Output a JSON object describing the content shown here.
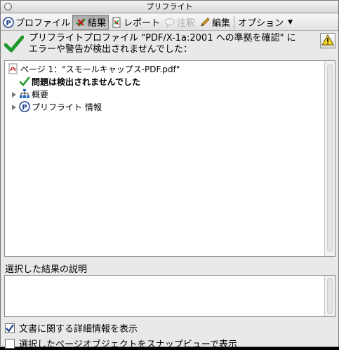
{
  "window": {
    "title": "プリフライト"
  },
  "toolbar": {
    "profiles_label": "プロファイル",
    "results_label": "結果",
    "report_label": "レポート",
    "comment_label": "注釈",
    "edit_label": "編集",
    "options_label": "オプション"
  },
  "summary": {
    "line1": "プリフライトプロファイル \"PDF/X-1a:2001 への準拠を確認\" に",
    "line2": "エラーや警告が検出されませんでした："
  },
  "results": {
    "page_label": "ページ 1：\"スモールキャップス-PDF.pdf\"",
    "no_problems_label": "問題は検出されませんでした",
    "overview_label": "概要",
    "preflight_info_label": "プリフライト 情報"
  },
  "description": {
    "label": "選択した結果の説明"
  },
  "options": {
    "show_details_label": "文書に関する詳細情報を表示",
    "show_details_checked": true,
    "snap_view_label": "選択したページオブジェクトをスナップビューで表示",
    "snap_view_checked": false
  },
  "colors": {
    "check_green": "#1e9a2a",
    "warning_yellow": "#f5d42a",
    "pdf_red": "#c4161c",
    "selected_toolbar": "#b5b5b5"
  }
}
